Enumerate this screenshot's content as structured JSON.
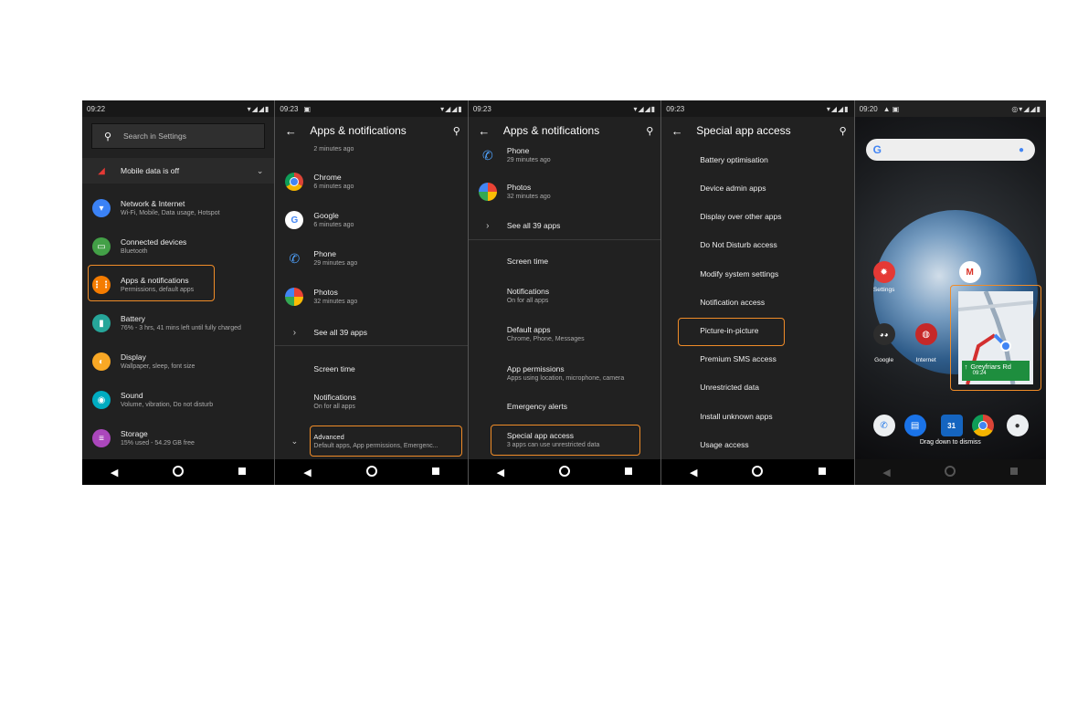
{
  "screens": {
    "s1": {
      "time": "09:22",
      "search_placeholder": "Search in Settings",
      "mobile_data": "Mobile data is off",
      "items": [
        {
          "title": "Network & Internet",
          "subtitle": "Wi-Fi, Mobile, Data usage, Hotspot",
          "color": "#3b82f6",
          "icon": "wifi-icon"
        },
        {
          "title": "Connected devices",
          "subtitle": "Bluetooth",
          "color": "#43a047",
          "icon": "devices-icon"
        },
        {
          "title": "Apps & notifications",
          "subtitle": "Permissions, default apps",
          "color": "#f57c00",
          "icon": "apps-icon"
        },
        {
          "title": "Battery",
          "subtitle": "76% - 3 hrs, 41 mins left until fully charged",
          "color": "#26a69a",
          "icon": "battery-icon"
        },
        {
          "title": "Display",
          "subtitle": "Wallpaper, sleep, font size",
          "color": "#f9a825",
          "icon": "display-icon"
        },
        {
          "title": "Sound",
          "subtitle": "Volume, vibration, Do not disturb",
          "color": "#00acc1",
          "icon": "sound-icon"
        },
        {
          "title": "Storage",
          "subtitle": "15% used - 54.29 GB free",
          "color": "#ab47bc",
          "icon": "storage-icon"
        }
      ]
    },
    "s2": {
      "time": "09:23",
      "title": "Apps & notifications",
      "partial_time": "2 minutes ago",
      "apps": [
        {
          "name": "Chrome",
          "time": "6 minutes ago",
          "icon": "chrome-icon"
        },
        {
          "name": "Google",
          "time": "6 minutes ago",
          "icon": "google-icon"
        },
        {
          "name": "Phone",
          "time": "29 minutes ago",
          "icon": "phone-icon"
        },
        {
          "name": "Photos",
          "time": "32 minutes ago",
          "icon": "photos-icon"
        }
      ],
      "see_all": "See all 39 apps",
      "screen_time": "Screen time",
      "notifications": "Notifications",
      "notifications_sub": "On for all apps",
      "advanced": "Advanced",
      "advanced_sub": "Default apps, App permissions, Emergenc..."
    },
    "s3": {
      "time": "09:23",
      "title": "Apps & notifications",
      "phone": "Phone",
      "phone_time": "29 minutes ago",
      "photos": "Photos",
      "photos_time": "32 minutes ago",
      "see_all": "See all 39 apps",
      "screen_time": "Screen time",
      "notifications": "Notifications",
      "notifications_sub": "On for all apps",
      "default_apps": "Default apps",
      "default_apps_sub": "Chrome, Phone, Messages",
      "app_permissions": "App permissions",
      "app_permissions_sub": "Apps using location, microphone, camera",
      "emergency": "Emergency alerts",
      "special": "Special app access",
      "special_sub": "3 apps can use unrestricted data"
    },
    "s4": {
      "time": "09:23",
      "title": "Special app access",
      "items": [
        "Battery optimisation",
        "Device admin apps",
        "Display over other apps",
        "Do Not Disturb access",
        "Modify system settings",
        "Notification access",
        "Picture-in-picture",
        "Premium SMS access",
        "Unrestricted data",
        "Install unknown apps",
        "Usage access"
      ]
    },
    "s5": {
      "time": "09:20",
      "settings_label": "Settings",
      "google_label": "Google",
      "internet_label": "Internet",
      "nav_street": "Greyfriars Rd",
      "nav_time": "09:24",
      "dismiss_hint": "Drag down to dismiss"
    }
  },
  "colors": {
    "highlight": "#f08c28",
    "background": "#212121"
  }
}
